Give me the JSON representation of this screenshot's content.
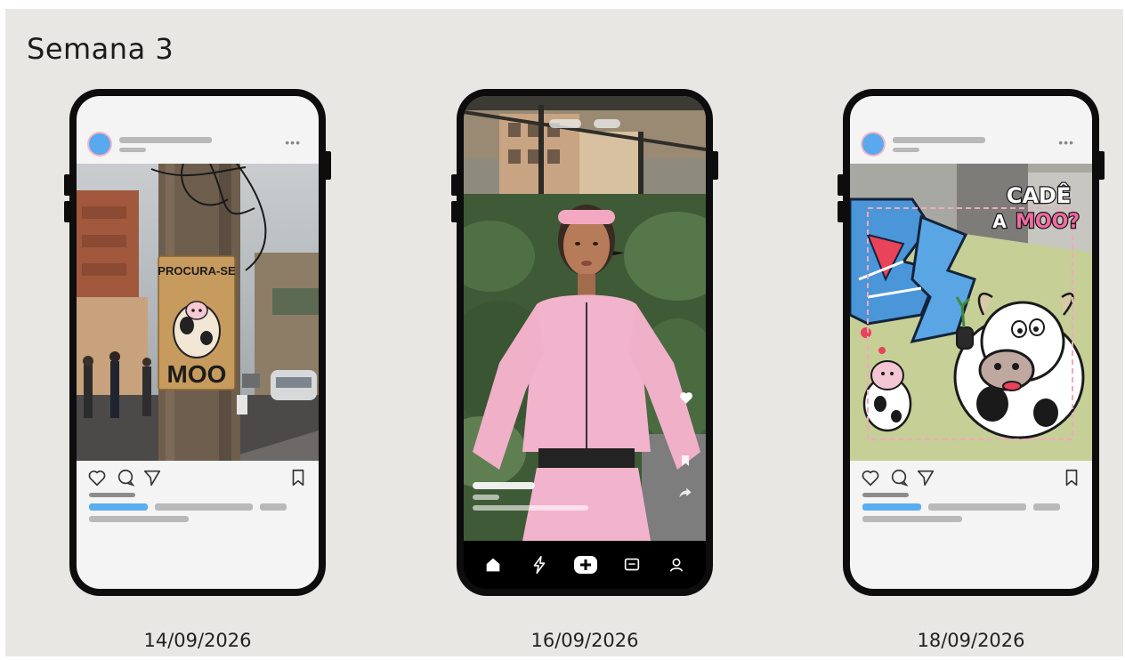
{
  "page": {
    "title": "Semana 3"
  },
  "posts": [
    {
      "type": "feed-post",
      "date": "14/09/2026",
      "image": "street-pole-poster-photo",
      "poster_text": [
        "PROCURA-SE",
        "MOO"
      ]
    },
    {
      "type": "reel",
      "date": "16/09/2026",
      "image": "woman-pink-tracksuit-photo"
    },
    {
      "type": "feed-post",
      "date": "18/09/2026",
      "image": "graffiti-cow-mural-photo",
      "overlay_text": [
        "CADÊ",
        "A",
        "MOO?"
      ]
    }
  ],
  "icons": {
    "feed_actions": [
      "heart-icon",
      "comment-icon",
      "share-icon",
      "bookmark-icon"
    ],
    "reel_side": [
      "heart-icon",
      "bookmark-icon",
      "share-icon"
    ],
    "reel_nav": [
      "home-icon",
      "reels-icon",
      "add-icon",
      "messages-icon",
      "profile-icon"
    ]
  },
  "colors": {
    "background": "#e8e7e4",
    "phone": "#0d0d0d",
    "avatar": "#5aa8ee",
    "accent_bar": "#5aaef0"
  }
}
